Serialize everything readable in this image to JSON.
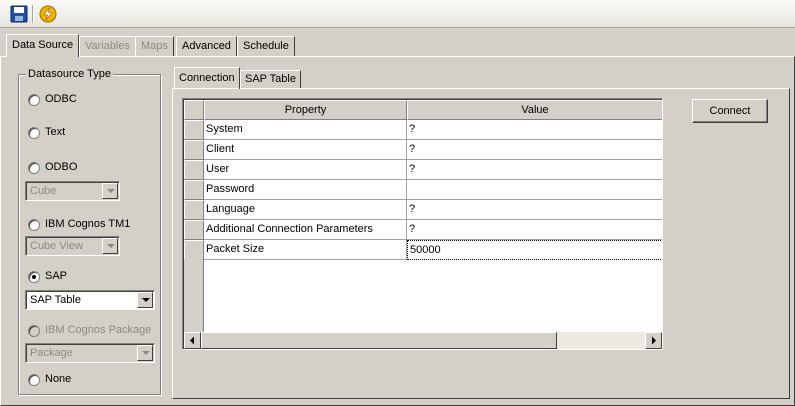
{
  "toolbar": {
    "items": [
      {
        "icon": "save-icon",
        "color": "#1f4fa8"
      },
      {
        "icon": "lightning-icon",
        "color": "#f2b300"
      }
    ]
  },
  "main_tabs": [
    {
      "label": "Data Source",
      "active": true,
      "enabled": true
    },
    {
      "label": "Variables",
      "active": false,
      "enabled": false
    },
    {
      "label": "Maps",
      "active": false,
      "enabled": false
    },
    {
      "label": "Advanced",
      "active": false,
      "enabled": true
    },
    {
      "label": "Schedule",
      "active": false,
      "enabled": true
    }
  ],
  "datasource": {
    "title": "Datasource Type",
    "options": {
      "odbc": "ODBC",
      "text": "Text",
      "odbo": "ODBO",
      "tm1": "IBM Cognos TM1",
      "sap": "SAP",
      "package": "IBM Cognos Package",
      "none": "None"
    },
    "selected": "sap",
    "odbo_combo": "Cube",
    "tm1_combo": "Cube View",
    "sap_combo": "SAP Table",
    "package_combo": "Package"
  },
  "inner_tabs": [
    {
      "label": "Connection",
      "active": true
    },
    {
      "label": "SAP Table",
      "active": false
    }
  ],
  "grid": {
    "headers": {
      "property": "Property",
      "value": "Value"
    },
    "rows": [
      {
        "property": "System",
        "value": "?"
      },
      {
        "property": "Client",
        "value": "?"
      },
      {
        "property": "User",
        "value": "?"
      },
      {
        "property": "Password",
        "value": ""
      },
      {
        "property": "Language",
        "value": "?"
      },
      {
        "property": "Additional Connection Parameters",
        "value": "?"
      },
      {
        "property": "Packet Size",
        "value": "50000"
      }
    ]
  },
  "connect_button": "Connect"
}
